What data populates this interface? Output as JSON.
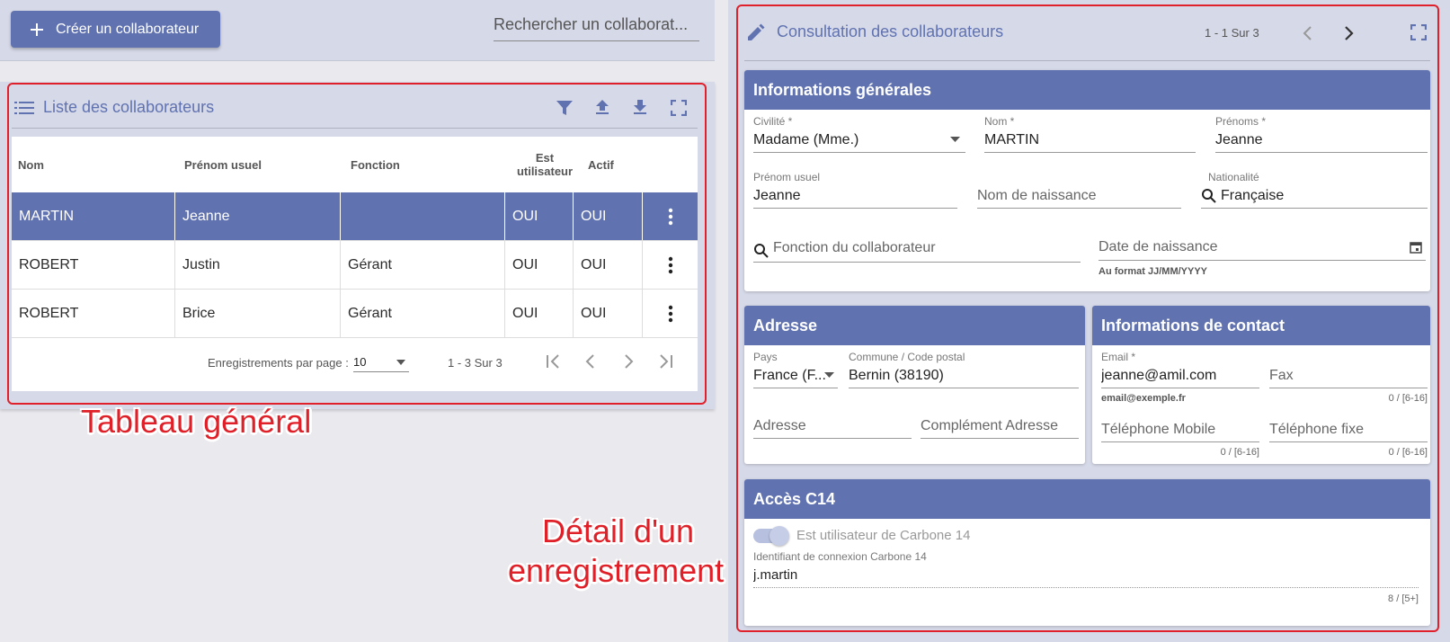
{
  "toolbar": {
    "create_label": "Créer un collaborateur",
    "search_placeholder": "Rechercher un collaborat..."
  },
  "list": {
    "title": "Liste des collaborateurs",
    "columns": [
      "Nom",
      "Prénom usuel",
      "Fonction",
      "Est utilisateur",
      "Actif"
    ],
    "rows": [
      {
        "nom": "MARTIN",
        "prenom": "Jeanne",
        "fonction": "",
        "utilisateur": "OUI",
        "actif": "OUI"
      },
      {
        "nom": "ROBERT",
        "prenom": "Justin",
        "fonction": "Gérant",
        "utilisateur": "OUI",
        "actif": "OUI"
      },
      {
        "nom": "ROBERT",
        "prenom": "Brice",
        "fonction": "Gérant",
        "utilisateur": "OUI",
        "actif": "OUI"
      }
    ],
    "pager": {
      "per_page_label": "Enregistrements par page :",
      "per_page": "10",
      "range": "1 - 3 Sur 3"
    }
  },
  "annotations": {
    "tableau": "Tableau général",
    "detail_line1": "Détail d'un",
    "detail_line2": "enregistrement"
  },
  "detail": {
    "title": "Consultation des collaborateurs",
    "pager": "1 - 1 Sur 3",
    "general": {
      "header": "Informations générales",
      "civilite_label": "Civilité *",
      "civilite": "Madame (Mme.)",
      "nom_label": "Nom *",
      "nom": "MARTIN",
      "prenoms_label": "Prénoms *",
      "prenoms": "Jeanne",
      "prenom_usuel_label": "Prénom usuel",
      "prenom_usuel": "Jeanne",
      "nom_naissance_placeholder": "Nom de naissance",
      "nationalite_label": "Nationalité",
      "nationalite": "Française",
      "fonction_placeholder": "Fonction du collaborateur",
      "date_placeholder": "Date de naissance",
      "date_hint": "Au format JJ/MM/YYYY"
    },
    "adresse": {
      "header": "Adresse",
      "pays_label": "Pays",
      "pays": "France (F...",
      "commune_label": "Commune / Code postal",
      "commune": "Bernin (38190)",
      "adresse_placeholder": "Adresse",
      "complement_placeholder": "Complément Adresse"
    },
    "contact": {
      "header": "Informations de contact",
      "email_label": "Email *",
      "email": "jeanne@amil.com",
      "email_hint": "email@exemple.fr",
      "fax_placeholder": "Fax",
      "fax_counter": "0 / [6-16]",
      "mobile_placeholder": "Téléphone Mobile",
      "mobile_counter": "0 / [6-16]",
      "fixe_placeholder": "Téléphone fixe",
      "fixe_counter": "0 / [6-16]"
    },
    "acces": {
      "header": "Accès C14",
      "toggle_label": "Est utilisateur de Carbone 14",
      "login_label": "Identifiant de connexion Carbone 14",
      "login": "j.martin",
      "login_counter": "8 / [5+]"
    }
  },
  "colors": {
    "accent": "#6072b0",
    "annotation": "#e02028",
    "panel_bg": "#d6d9e8"
  }
}
